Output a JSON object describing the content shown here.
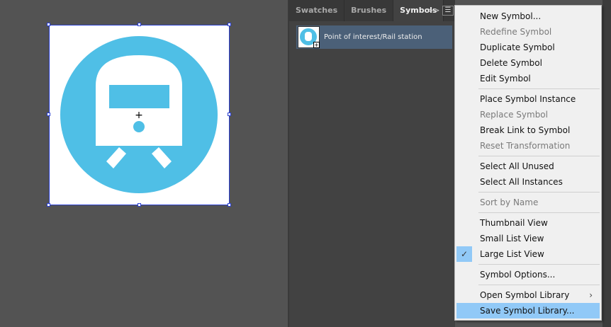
{
  "panel": {
    "tabs": [
      "Swatches",
      "Brushes",
      "Symbols"
    ],
    "active_tab": "Symbols",
    "overflow": ">>",
    "menu_icon": "hamburger-icon",
    "symbol": {
      "name": "Point of interest/Rail station"
    }
  },
  "menu": {
    "items": [
      {
        "label": "New Symbol...",
        "disabled": false
      },
      {
        "label": "Redefine Symbol",
        "disabled": true
      },
      {
        "label": "Duplicate Symbol",
        "disabled": false
      },
      {
        "label": "Delete Symbol",
        "disabled": false
      },
      {
        "label": "Edit Symbol",
        "disabled": false
      },
      {
        "sep": true
      },
      {
        "label": "Place Symbol Instance",
        "disabled": false
      },
      {
        "label": "Replace Symbol",
        "disabled": true
      },
      {
        "label": "Break Link to Symbol",
        "disabled": false
      },
      {
        "label": "Reset Transformation",
        "disabled": true
      },
      {
        "sep": true
      },
      {
        "label": "Select All Unused",
        "disabled": false
      },
      {
        "label": "Select All Instances",
        "disabled": false
      },
      {
        "sep": true
      },
      {
        "label": "Sort by Name",
        "disabled": true
      },
      {
        "sep": true
      },
      {
        "label": "Thumbnail View",
        "disabled": false
      },
      {
        "label": "Small List View",
        "disabled": false
      },
      {
        "label": "Large List View",
        "disabled": false,
        "checked": true
      },
      {
        "sep": true
      },
      {
        "label": "Symbol Options...",
        "disabled": false
      },
      {
        "sep": true
      },
      {
        "label": "Open Symbol Library",
        "disabled": false,
        "submenu": true
      },
      {
        "label": "Save Symbol Library...",
        "disabled": false,
        "highlighted": true
      }
    ]
  },
  "colors": {
    "symbol": "#4fbfe6",
    "highlight": "#91c9f7"
  }
}
